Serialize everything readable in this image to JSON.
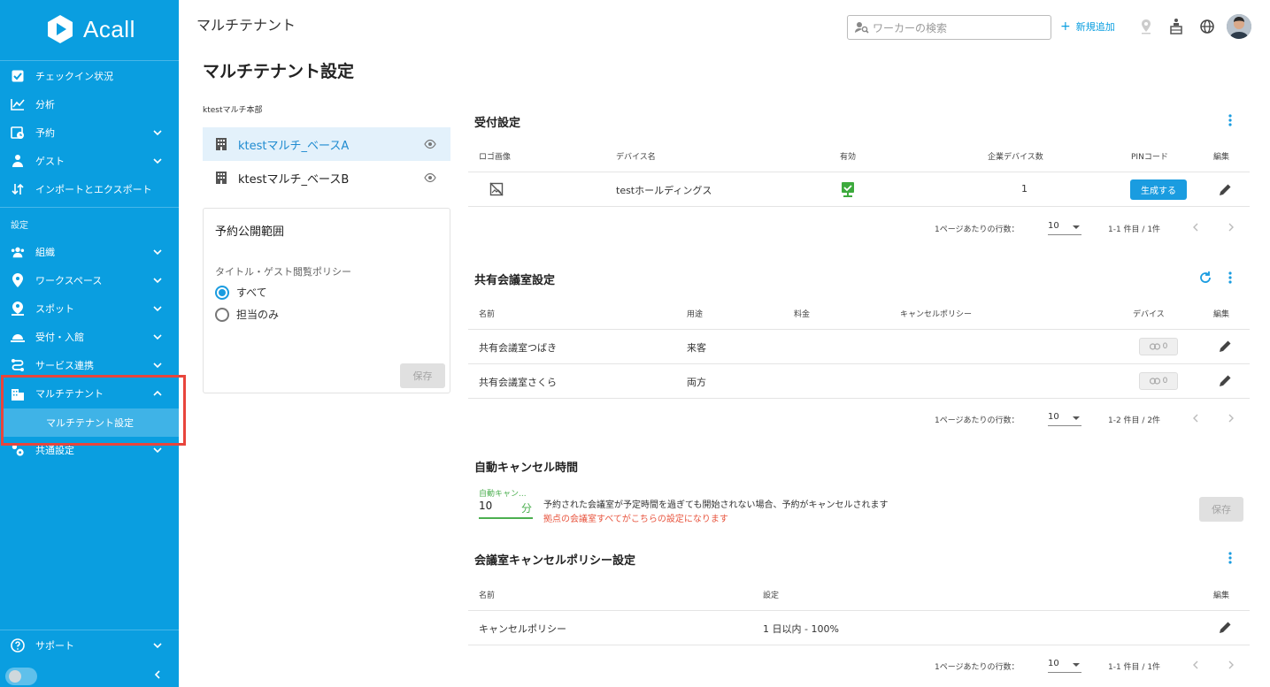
{
  "app": {
    "logo_text": "Acall"
  },
  "sidebar": {
    "items": [
      {
        "label": "チェックイン状況"
      },
      {
        "label": "分析"
      },
      {
        "label": "予約"
      },
      {
        "label": "ゲスト"
      },
      {
        "label": "インポートとエクスポート"
      }
    ],
    "settings_label": "設定",
    "settings_items": [
      {
        "label": "組織"
      },
      {
        "label": "ワークスペース"
      },
      {
        "label": "スポット"
      },
      {
        "label": "受付・入館"
      },
      {
        "label": "サービス連携"
      },
      {
        "label": "マルチテナント"
      },
      {
        "label": "共通設定"
      }
    ],
    "active_sub_item": "マルチテナント設定",
    "support_label": "サポート"
  },
  "header": {
    "title": "マルチテナント",
    "search_placeholder": "ワーカーの検索",
    "add_label": "新規追加"
  },
  "page": {
    "title": "マルチテナント設定",
    "org_name": "ktestマルチ本部",
    "bases": [
      {
        "name": "ktestマルチ_ベースA",
        "active": true
      },
      {
        "name": "ktestマルチ_ベースB",
        "active": false
      }
    ],
    "publication": {
      "title": "予約公開範囲",
      "policy_label": "タイトル・ゲスト閲覧ポリシー",
      "options": [
        "すべて",
        "担当のみ"
      ],
      "selected": "すべて",
      "save_label": "保存"
    }
  },
  "reception": {
    "title": "受付設定",
    "columns": [
      "ロゴ画像",
      "デバイス名",
      "有効",
      "企業デバイス数",
      "PINコード",
      "編集"
    ],
    "rows": [
      {
        "device_name": "testホールディングス",
        "enabled": true,
        "company_devices": "1",
        "pin_button": "生成する"
      }
    ],
    "pager": {
      "rows_per_page_label": "1ページあたりの行数：",
      "rows_per_page": "10",
      "range": "1-1 件目 / 1件"
    }
  },
  "shared_rooms": {
    "title": "共有会議室設定",
    "columns": [
      "名前",
      "用途",
      "料金",
      "キャンセルポリシー",
      "デバイス",
      "編集"
    ],
    "rows": [
      {
        "name": "共有会議室つばき",
        "use": "来客",
        "fee": "",
        "policy": "",
        "devices": "0"
      },
      {
        "name": "共有会議室さくら",
        "use": "両方",
        "fee": "",
        "policy": "",
        "devices": "0"
      }
    ],
    "pager": {
      "rows_per_page_label": "1ページあたりの行数：",
      "rows_per_page": "10",
      "range": "1-2 件目 / 2件"
    }
  },
  "auto_cancel": {
    "title": "自動キャンセル時間",
    "field_label": "自動キャン...",
    "value": "10",
    "unit": "分",
    "description": "予約された会議室が予定時間を過ぎても開始されない場合、予約がキャンセルされます",
    "warning": "拠点の会議室すべてがこちらの設定になります",
    "save_label": "保存"
  },
  "cancel_policy": {
    "title": "会議室キャンセルポリシー設定",
    "columns": [
      "名前",
      "設定",
      "編集"
    ],
    "rows": [
      {
        "name": "キャンセルポリシー",
        "setting": "1 日以内 - 100%"
      }
    ],
    "pager": {
      "rows_per_page_label": "1ページあたりの行数：",
      "rows_per_page": "10",
      "range": "1-1 件目 / 1件"
    }
  },
  "colors": {
    "brand": "#0a9ee0",
    "highlight": "#e8453c",
    "warning": "#e8553f",
    "success": "#4caf50"
  }
}
